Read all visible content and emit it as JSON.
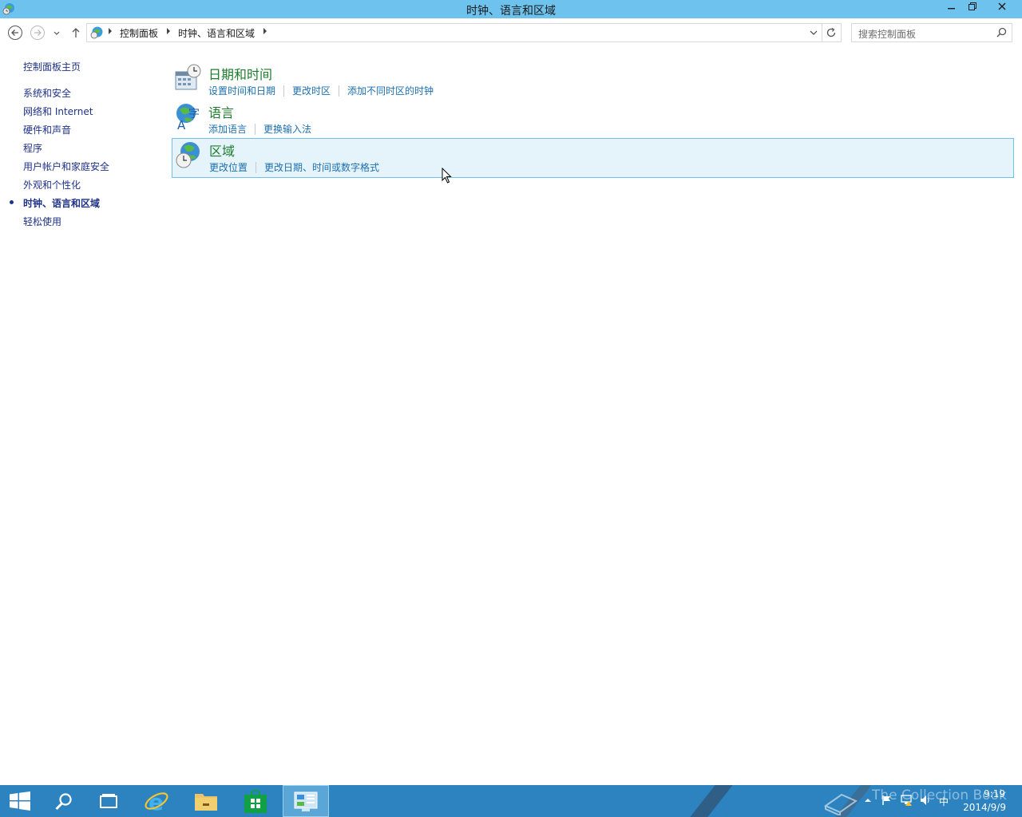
{
  "window": {
    "title": "时钟、语言和区域",
    "minimize_icon": "minimize-icon",
    "restore_icon": "restore-icon",
    "close_icon": "close-icon"
  },
  "address_bar": {
    "breadcrumbs": [
      "控制面板",
      "时钟、语言和区域"
    ],
    "search_placeholder": "搜索控制面板"
  },
  "sidebar": {
    "items": [
      {
        "label": "控制面板主页"
      },
      {
        "label": "系统和安全"
      },
      {
        "label": "网络和 Internet"
      },
      {
        "label": "硬件和声音"
      },
      {
        "label": "程序"
      },
      {
        "label": "用户帐户和家庭安全"
      },
      {
        "label": "外观和个性化"
      },
      {
        "label": "时钟、语言和区域",
        "current": true
      },
      {
        "label": "轻松使用"
      }
    ]
  },
  "categories": [
    {
      "title": "日期和时间",
      "icon": "calendar-clock-icon",
      "links": [
        "设置时间和日期",
        "更改时区",
        "添加不同时区的时钟"
      ]
    },
    {
      "title": "语言",
      "icon": "language-globe-icon",
      "links": [
        "添加语言",
        "更换输入法"
      ]
    },
    {
      "title": "区域",
      "icon": "region-globe-icon",
      "links": [
        "更改位置",
        "更改日期、时间或数字格式"
      ],
      "hovered": true
    }
  ],
  "taskbar": {
    "pinned": [
      "start-icon",
      "search-icon",
      "task-view-icon",
      "internet-explorer-icon",
      "file-explorer-icon",
      "store-icon",
      "control-panel-icon"
    ],
    "active": "control-panel-icon",
    "time": "9:19",
    "date": "2014/9/9",
    "ime": "中",
    "watermark": "The Collection Book"
  },
  "colors": {
    "titlebar": "#6ec2ee",
    "taskbar": "#2c83c0",
    "category_title": "#1e7b2c",
    "link": "#1e6fb0",
    "hover_bg": "#e5f3fb"
  }
}
